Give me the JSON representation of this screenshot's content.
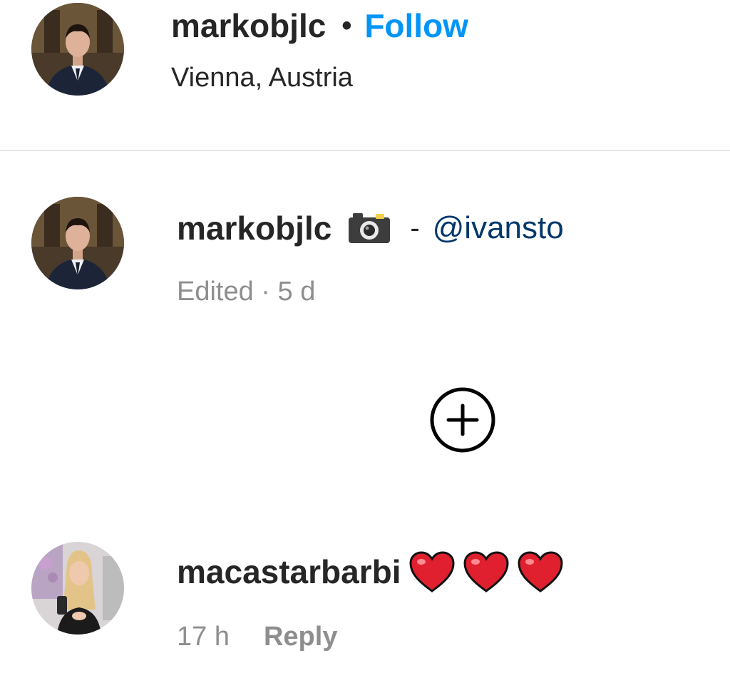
{
  "post_header": {
    "username": "markobjlc",
    "separator": "•",
    "follow_label": "Follow",
    "location": "Vienna, Austria"
  },
  "caption": {
    "username": "markobjlc",
    "emoji_icon": "camera-with-flash-icon",
    "dash": "-",
    "mention": "@ivansto",
    "meta": "Edited · 5 d"
  },
  "load_more": {
    "icon": "plus-circle-icon"
  },
  "comment": {
    "username": "macastarbarbi",
    "hearts": [
      "red-heart-icon",
      "red-heart-icon",
      "red-heart-icon"
    ],
    "time": "17 h",
    "reply_label": "Reply"
  },
  "colors": {
    "link_blue": "#0095f6",
    "mention_blue": "#00376b",
    "muted": "#8e8e8e",
    "text": "#262626",
    "heart_red": "#e0202e"
  }
}
